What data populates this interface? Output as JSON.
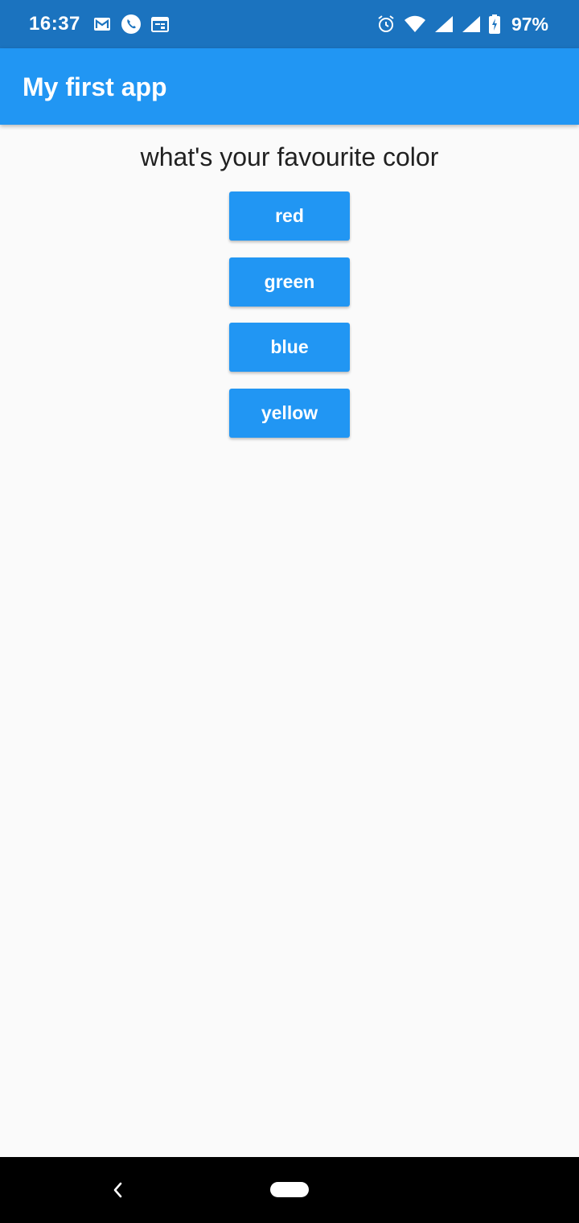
{
  "status_bar": {
    "time": "16:37",
    "left_icons": [
      "gmail-icon",
      "phone-icon",
      "calendar-icon"
    ],
    "right_icons": [
      "alarm-icon",
      "wifi-icon",
      "signal-icon",
      "signal-icon",
      "battery-charging-icon"
    ],
    "battery": "97%"
  },
  "app_bar": {
    "title": "My first app",
    "color": "#2196f3"
  },
  "main": {
    "question": "what's your favourite color",
    "buttons": [
      {
        "label": "red"
      },
      {
        "label": "green"
      },
      {
        "label": "blue"
      },
      {
        "label": "yellow"
      }
    ],
    "button_color": "#2196f3"
  },
  "nav_bar": {
    "icons": [
      "back-icon",
      "home-pill-icon"
    ]
  }
}
